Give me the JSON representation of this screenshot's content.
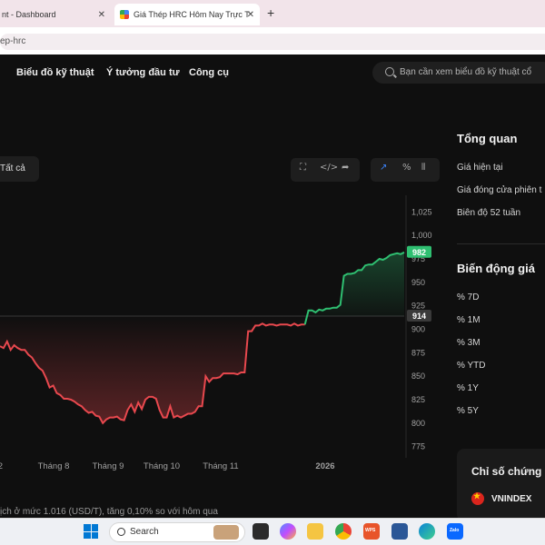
{
  "browser": {
    "tabs": [
      {
        "title": "nt - Dashboard"
      },
      {
        "title": "Giá Thép HRC Hôm Nay Trực Tu"
      }
    ],
    "url": "ep-hrc"
  },
  "nav": {
    "links": [
      "Biểu đồ kỹ thuật",
      "Ý tưởng đầu tư",
      "Công cụ"
    ],
    "search_placeholder": "Bạn cần xem biểu đồ kỹ thuật cổ"
  },
  "chart_toolbar": {
    "filter_label": "Tất cả",
    "tools_left": [
      "fullscreen-icon",
      "embed-code-icon",
      "share-icon"
    ],
    "tools_right": [
      "line-chart-icon",
      "percent-icon",
      "compare-icon"
    ],
    "percent_label": "%"
  },
  "chart_data": {
    "type": "line",
    "x_ticks": [
      "2",
      "Tháng 8",
      "Tháng 9",
      "Tháng 10",
      "Tháng 11",
      "2026"
    ],
    "y_ticks": [
      775,
      800,
      825,
      850,
      875,
      900,
      925,
      950,
      975,
      1000,
      1025
    ],
    "ylim": [
      765,
      1035
    ],
    "baseline": 914,
    "last_value": 982,
    "baseline_label": "914",
    "last_label": "982",
    "colors": {
      "below": "#e8484e",
      "above": "#2fbf71"
    },
    "series": [
      {
        "values": [
          882,
          880,
          887,
          878,
          883,
          880,
          878,
          878,
          873,
          870,
          864,
          859,
          856,
          848,
          838,
          840,
          832,
          830,
          826,
          826,
          825,
          823,
          820,
          818,
          814,
          811,
          812,
          808,
          807,
          800,
          804,
          806,
          806,
          807,
          804,
          803,
          814,
          820,
          812,
          822,
          815,
          825,
          828,
          828,
          826,
          814,
          806,
          806,
          818,
          806,
          808,
          806,
          808,
          810,
          810,
          812,
          818,
          818,
          850,
          844,
          848,
          848,
          849,
          853,
          853,
          853,
          853,
          852,
          854,
          854,
          898,
          898,
          904,
          904,
          906,
          904,
          905,
          905,
          904,
          905,
          905,
          905,
          904,
          906,
          904,
          905,
          905,
          920,
          920,
          918,
          921,
          920,
          922,
          922,
          923,
          923,
          926,
          957,
          959,
          959,
          960,
          963,
          963,
          968,
          969,
          969,
          972,
          975,
          974,
          976,
          979,
          980,
          981,
          980,
          982
        ]
      }
    ],
    "caption": "ịch ở mức 1.016 (USD/T), tăng 0,10% so với hôm qua"
  },
  "overview": {
    "title": "Tổng quan",
    "rows": [
      "Giá hiện tại",
      "Giá đóng cửa phiên t",
      "Biên độ 52 tuần"
    ]
  },
  "price_change": {
    "title": "Biến động giá",
    "rows": [
      "% 7D",
      "% 1M",
      "% 3M",
      "% YTD",
      "% 1Y",
      "% 5Y"
    ]
  },
  "indices": {
    "title": "Chỉ số chứng",
    "items": [
      {
        "name": "VNINDEX"
      }
    ]
  },
  "taskbar": {
    "search_label": "Search",
    "apps": [
      "file-explorer-icon",
      "copilot-icon",
      "folder-icon",
      "chrome-icon",
      "wps-icon",
      "word-icon",
      "edge-icon",
      "zalo-icon"
    ],
    "wps_label": "WPS",
    "zalo_label": "Zalo"
  }
}
